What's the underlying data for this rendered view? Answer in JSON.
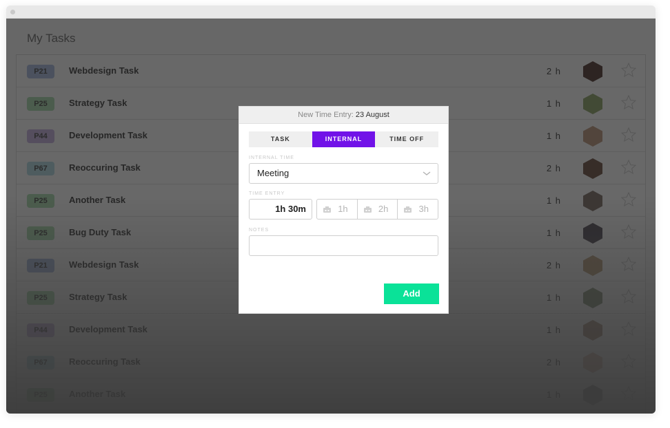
{
  "page": {
    "title": "My Tasks"
  },
  "tasks": [
    {
      "code": "P21",
      "name": "Webdesign Task",
      "hours": "2 h",
      "badge_color": "#9db3dc",
      "avatar_color": "#3a1d14"
    },
    {
      "code": "P25",
      "name": "Strategy Task",
      "hours": "1 h",
      "badge_color": "#9fd7a4",
      "avatar_color": "#7f9a55"
    },
    {
      "code": "P44",
      "name": "Development Task",
      "hours": "1 h",
      "badge_color": "#bfa9dc",
      "avatar_color": "#b58a6c"
    },
    {
      "code": "P67",
      "name": "Reoccuring Task",
      "hours": "2 h",
      "badge_color": "#a9d7e0",
      "avatar_color": "#5a3a2a"
    },
    {
      "code": "P25",
      "name": "Another Task",
      "hours": "1 h",
      "badge_color": "#9fd7a4",
      "avatar_color": "#6c5a52"
    },
    {
      "code": "P25",
      "name": "Bug Duty Task",
      "hours": "1 h",
      "badge_color": "#9fd7a4",
      "avatar_color": "#3b3340"
    },
    {
      "code": "P21",
      "name": "Webdesign Task",
      "hours": "2 h",
      "badge_color": "#9db3dc",
      "avatar_color": "#b5956c"
    },
    {
      "code": "P25",
      "name": "Strategy Task",
      "hours": "1 h",
      "badge_color": "#9fd7a4",
      "avatar_color": "#7a8a6a"
    },
    {
      "code": "P44",
      "name": "Development Task",
      "hours": "1 h",
      "badge_color": "#bfa9dc",
      "avatar_color": "#a38670"
    },
    {
      "code": "P67",
      "name": "Reoccuring Task",
      "hours": "2 h",
      "badge_color": "#a9d7e0",
      "avatar_color": "#d9b4a0"
    },
    {
      "code": "P25",
      "name": "Another Task",
      "hours": "1 h",
      "badge_color": "#9fd7a4",
      "avatar_color": "#8a8a8a"
    }
  ],
  "modal": {
    "header_prefix": "New Time Entry:",
    "header_date": "23 August",
    "tabs": [
      {
        "label": "TASK",
        "active": false
      },
      {
        "label": "INTERNAL",
        "active": true
      },
      {
        "label": "TIME OFF",
        "active": false
      }
    ],
    "internal_time_label": "INTERNAL TIME",
    "internal_time_value": "Meeting",
    "time_entry_label": "TIME ENTRY",
    "time_entry_value": "1h 30m",
    "presets": [
      "1h",
      "2h",
      "3h"
    ],
    "notes_label": "NOTES",
    "notes_value": "",
    "add_label": "Add"
  },
  "colors": {
    "accent": "#7112e8",
    "add_button": "#0ae298"
  }
}
